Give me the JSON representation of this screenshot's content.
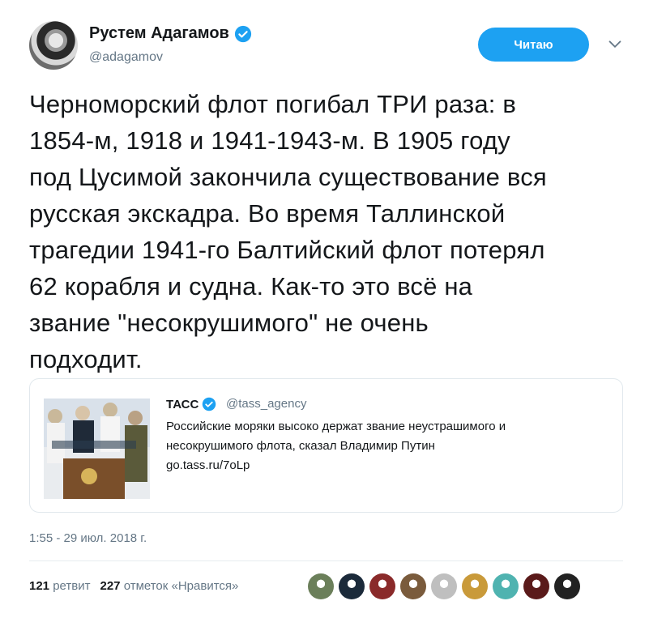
{
  "author": {
    "name": "Рустем Адагамов",
    "handle": "@adagamov",
    "verified": true
  },
  "follow_button": {
    "label": "Читаю"
  },
  "tweet": {
    "text": "Черноморский флот погибал ТРИ раза: в\n1854-м, 1918 и 1941-1943-м. В 1905 году\nпод Цусимой закончила существование вся\nрусская экскадра. Во время Таллинской\nтрагедии 1941-го Балтийский флот потерял\n62 корабля и судна. Как-то это всё на\nзвание \"несокрушимого\" не очень\nподходит.",
    "timestamp": "1:55 - 29 июл. 2018 г."
  },
  "quoted_tweet": {
    "name": "ТАСС",
    "handle": "@tass_agency",
    "verified": true,
    "text_line1": "Российские моряки высоко держат звание неустрашимого и",
    "text_line2": "несокрушимого флота, сказал Владимир Путин",
    "link": "go.tass.ru/7oLp"
  },
  "stats": {
    "retweets_count": "121",
    "retweets_label": "ретвит",
    "likes_count": "227",
    "likes_label": "отметок «Нравится»"
  },
  "colors": {
    "accent": "#1da1f2",
    "secondary_text": "#657786",
    "primary_text": "#14171a",
    "border": "#e1e8ed"
  },
  "icons": [
    "verified-badge-icon",
    "chevron-down-icon"
  ],
  "liker_avatars": [
    {
      "color": "#6b7f5a"
    },
    {
      "color": "#1b2a3a"
    },
    {
      "color": "#8a2a2a"
    },
    {
      "color": "#7a5b3c"
    },
    {
      "color": "#bfbfbf"
    },
    {
      "color": "#c99a3a"
    },
    {
      "color": "#4fb3b0"
    },
    {
      "color": "#5a1a1a"
    },
    {
      "color": "#222222"
    }
  ]
}
